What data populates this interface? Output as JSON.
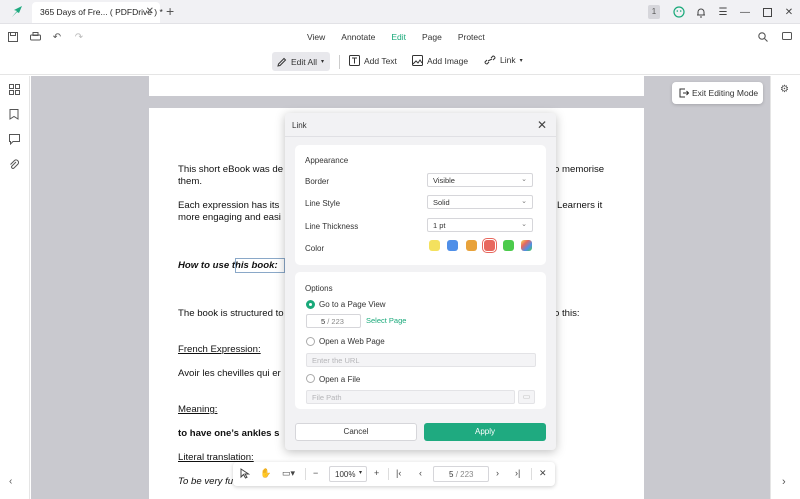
{
  "tab": {
    "title": "365 Days of Fre... ( PDFDrive ) *"
  },
  "window": {
    "badge": "1"
  },
  "menu": {
    "tabs": [
      "View",
      "Annotate",
      "Edit",
      "Page",
      "Protect"
    ],
    "active": "Edit"
  },
  "edit_toolbar": {
    "edit_all": "Edit All",
    "add_text": "Add Text",
    "add_image": "Add Image",
    "link": "Link"
  },
  "exit_editing": "Exit Editing Mode",
  "document": {
    "lines": [
      "This short eBook was de",
      "them.",
      "Each expression has its",
      "more engaging and easi",
      "How to use this book:",
      "The book is structured to",
      "French Expression:",
      "Avoir les chevilles qui er",
      "Meaning:",
      "to have one’s ankles s",
      "Literal translation:",
      "To be very fu"
    ],
    "right_fragments": [
      "o memorise",
      "Learners it",
      "o this:"
    ]
  },
  "dialog": {
    "title": "Link",
    "appearance": {
      "heading": "Appearance",
      "border_label": "Border",
      "border_value": "Visible",
      "line_style_label": "Line Style",
      "line_style_value": "Solid",
      "line_thickness_label": "Line Thickness",
      "line_thickness_value": "1 pt",
      "color_label": "Color",
      "colors": [
        "#f4e15e",
        "#4f8fe8",
        "#e8a23a",
        "#e8675d",
        "#4ccb4c",
        "multicolor"
      ],
      "selected_color": "#e8675d"
    },
    "options": {
      "heading": "Options",
      "goto_page": "Go to a Page View",
      "page_current": "5",
      "page_total": "/  223",
      "select_page": "Select Page",
      "open_web": "Open a Web Page",
      "url_placeholder": "Enter the URL",
      "open_file": "Open a File",
      "file_placeholder": "File Path"
    },
    "cancel": "Cancel",
    "apply": "Apply"
  },
  "bottom_bar": {
    "zoom": "100%",
    "page_current": "5",
    "page_total": "/  223"
  }
}
